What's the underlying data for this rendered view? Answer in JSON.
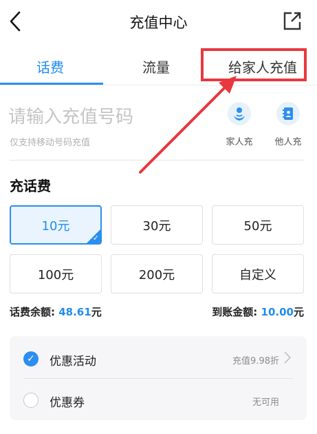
{
  "header": {
    "title": "充值中心",
    "back_icon": "chevron-left-icon",
    "share_icon": "share-external-icon"
  },
  "tabs": [
    {
      "label": "话费",
      "active": true
    },
    {
      "label": "流量",
      "active": false
    },
    {
      "label": "给家人充值",
      "active": false
    }
  ],
  "phone": {
    "placeholder": "请输入充值号码",
    "hint": "仅支持移动号码充值"
  },
  "contacts": [
    {
      "label": "家人充",
      "icon": "family-heart-icon"
    },
    {
      "label": "他人充",
      "icon": "contacts-book-icon"
    }
  ],
  "recharge": {
    "title": "充话费",
    "amounts": [
      {
        "label": "10元",
        "selected": true
      },
      {
        "label": "30元",
        "selected": false
      },
      {
        "label": "50元",
        "selected": false
      },
      {
        "label": "100元",
        "selected": false
      },
      {
        "label": "200元",
        "selected": false
      },
      {
        "label": "自定义",
        "selected": false
      }
    ],
    "balance_label": "话费余额:",
    "balance_value": "48.61",
    "balance_unit": "元",
    "credit_label": "到账金额:",
    "credit_value": "10.00",
    "credit_unit": "元"
  },
  "offers": [
    {
      "label": "优惠活动",
      "value": "充值9.98折",
      "checked": true
    },
    {
      "label": "优惠券",
      "value": "无可用",
      "checked": false
    }
  ],
  "colors": {
    "accent": "#2b8ef0",
    "annotation": "#e8383d"
  }
}
